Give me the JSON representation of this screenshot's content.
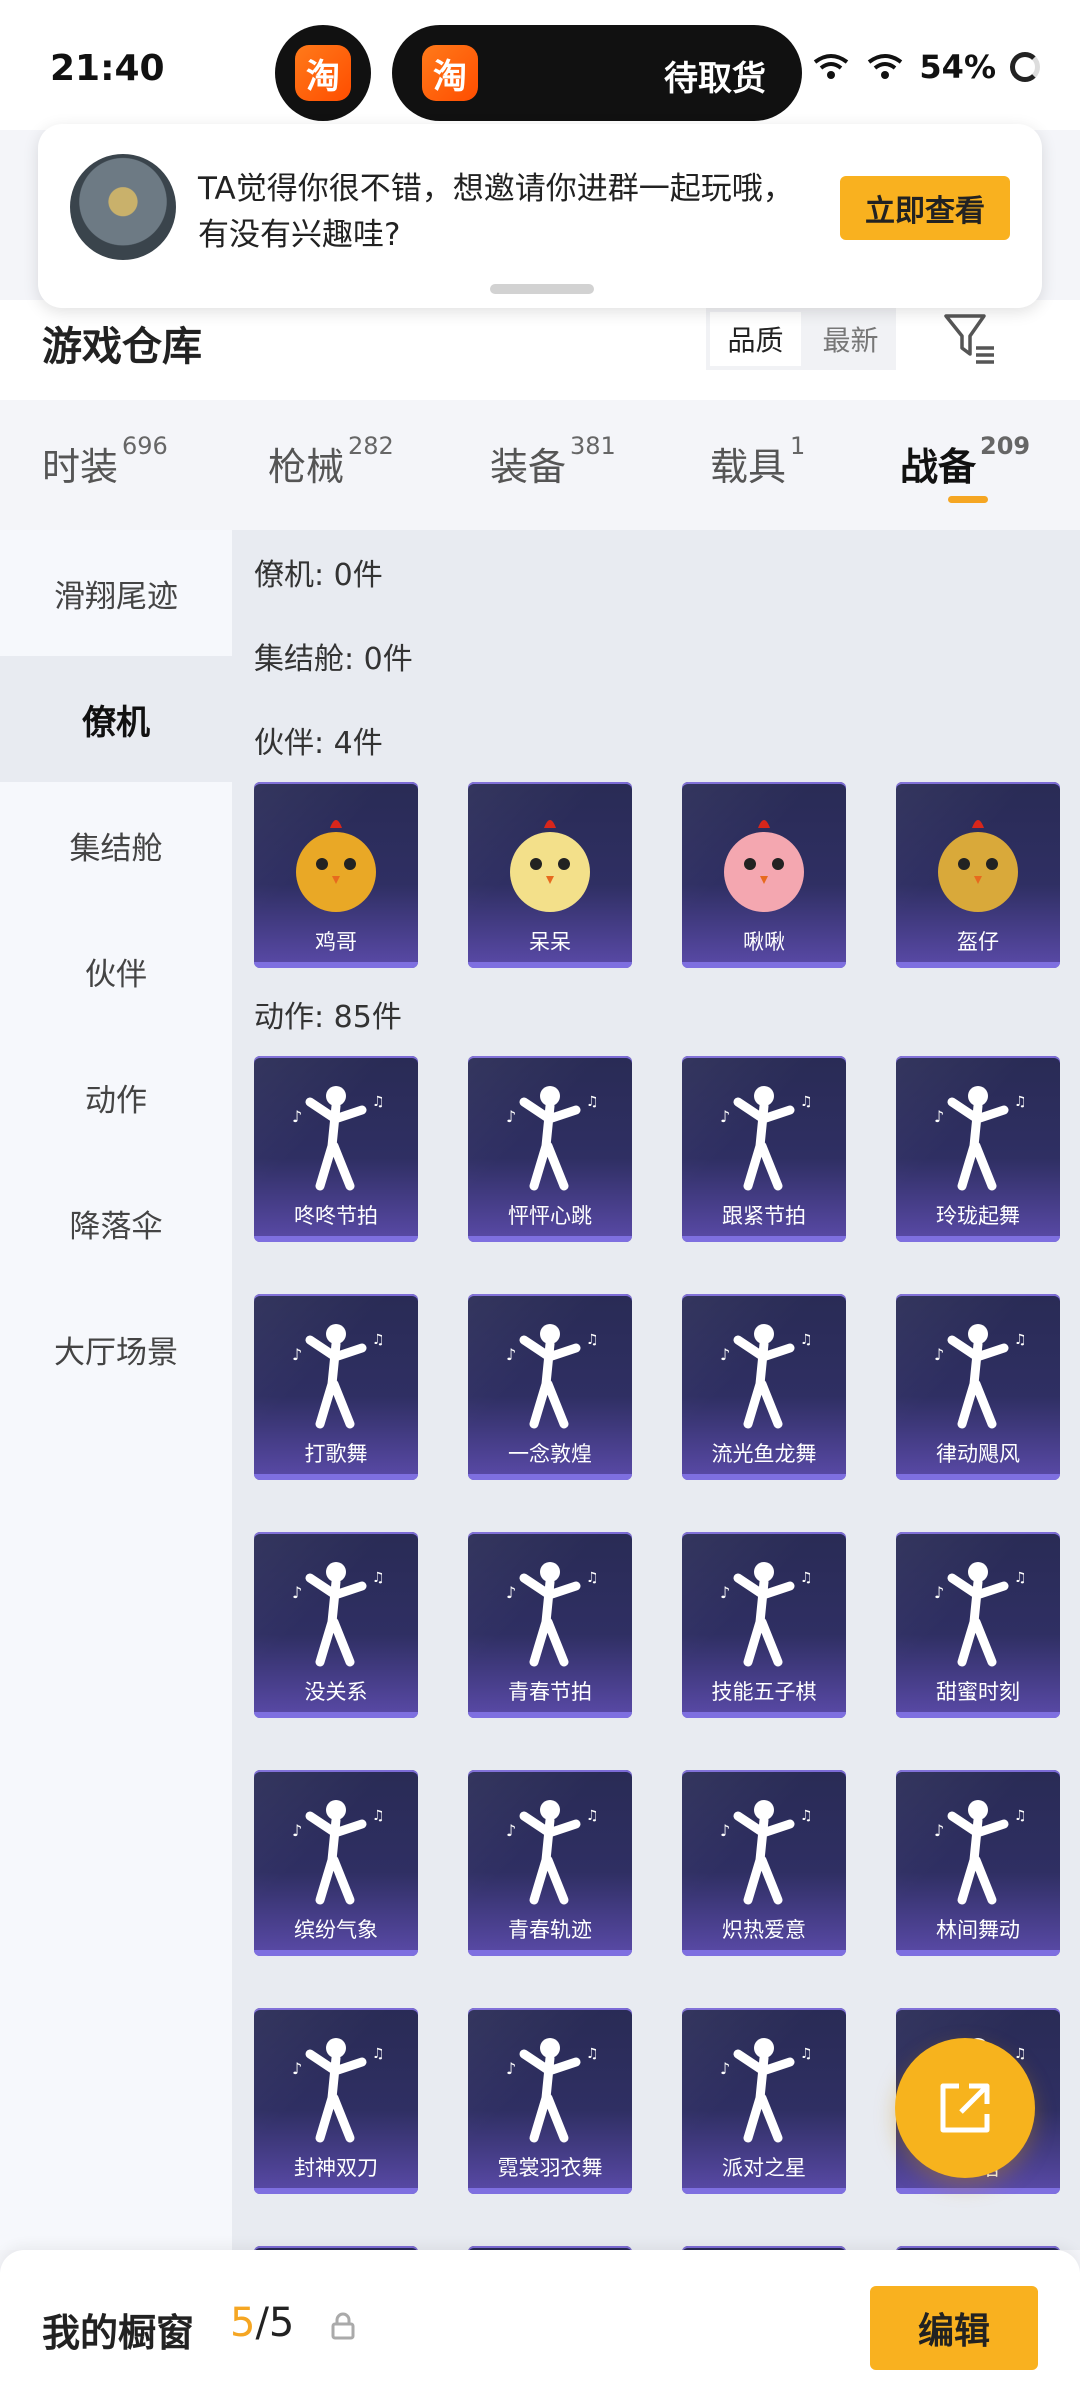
{
  "status_bar": {
    "time": "21:40",
    "taobao_logo": "淘",
    "pickup_text": "待取货",
    "battery": "54%"
  },
  "notification": {
    "message": "TA觉得你很不错，想邀请你进群一起玩哦，有没有兴趣哇?",
    "button_label": "立即查看"
  },
  "header": {
    "title": "游戏仓库",
    "sort_options": [
      "品质",
      "最新"
    ]
  },
  "tabs": [
    {
      "label": "时装",
      "count": "696"
    },
    {
      "label": "枪械",
      "count": "282"
    },
    {
      "label": "装备",
      "count": "381"
    },
    {
      "label": "载具",
      "count": "1"
    },
    {
      "label": "战备",
      "count": "209"
    }
  ],
  "sidebar": {
    "items": [
      "滑翔尾迹",
      "僚机",
      "集结舱",
      "伙伴",
      "动作",
      "降落伞",
      "大厅场景"
    ]
  },
  "sections": {
    "wingman": "僚机: 0件",
    "pod": "集结舱: 0件",
    "partner": "伙伴: 4件",
    "emote": "动作: 85件"
  },
  "partners": [
    "鸡哥",
    "呆呆",
    "啾啾",
    "盔仔"
  ],
  "emotes": [
    "咚咚节拍",
    "怦怦心跳",
    "跟紧节拍",
    "玲珑起舞",
    "打歌舞",
    "一念敦煌",
    "流光鱼龙舞",
    "律动飓风",
    "没关系",
    "青春节拍",
    "技能五子棋",
    "甜蜜时刻",
    "缤纷气象",
    "青春轨迹",
    "炽热爱意",
    "林间舞动",
    "封神双刀",
    "霓裳羽衣舞",
    "派对之星",
    "舞蹈"
  ],
  "bottom_bar": {
    "title": "我的橱窗",
    "current": "5",
    "total": "/5",
    "edit_label": "编辑"
  },
  "colors": {
    "accent": "#f9b11f",
    "card_dark": "#292b55",
    "card_light": "#5a4aa8"
  }
}
